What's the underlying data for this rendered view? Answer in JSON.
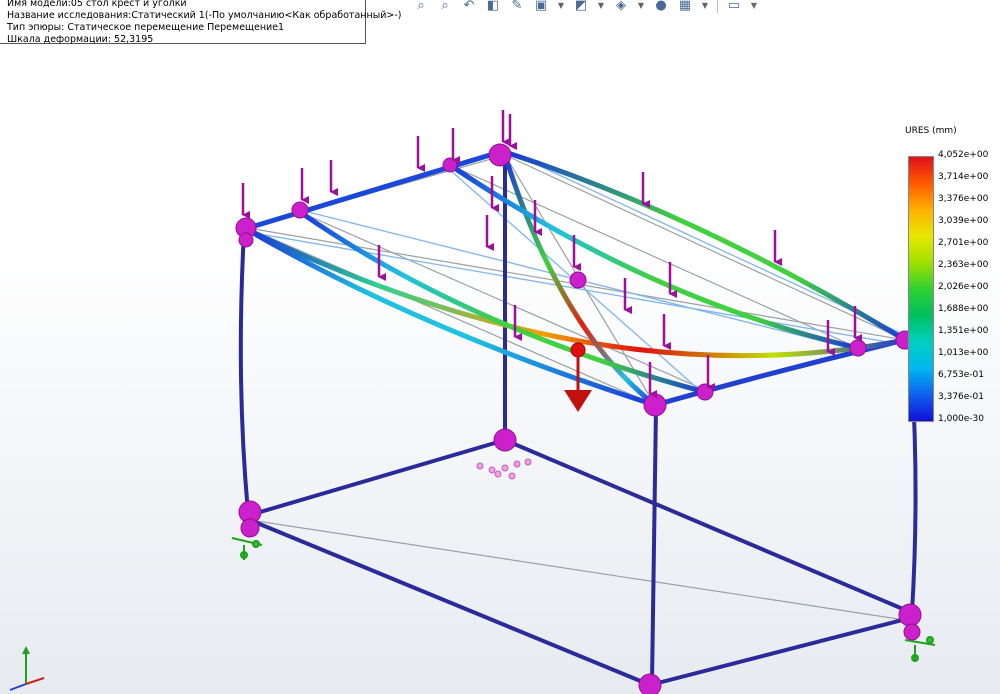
{
  "info": {
    "model_line": "Имя модели:05 стол крест и уголки",
    "study_line": "Название исследования:Статический 1(-По умолчанию<Как обработанный>-)",
    "plot_line": "Тип эпюры: Статическое перемещение Перемещение1",
    "scale_line": "Шкала деформации: 52,3195"
  },
  "toolbar": {
    "icons": [
      "zoom-to-fit-icon",
      "zoom-area-icon",
      "previous-view-icon",
      "section-view-icon",
      "dynamic-annotation-icon",
      "view-orientation-icon",
      "display-style-icon",
      "hide-show-items-icon",
      "edit-appearance-icon",
      "apply-scene-icon",
      "view-settings-icon"
    ]
  },
  "legend": {
    "title": "URES (mm)",
    "labels": [
      "4,052e+00",
      "3,714e+00",
      "3,376e+00",
      "3,039e+00",
      "2,701e+00",
      "2,363e+00",
      "2,026e+00",
      "1,688e+00",
      "1,351e+00",
      "1,013e+00",
      "6,753e-01",
      "3,376e-01",
      "1,000e-30"
    ],
    "colors": {
      "max": "#e0101a",
      "mid": "#30d030",
      "min": "#1010d8"
    }
  },
  "model": {
    "frame_color": "#2a2a9a",
    "load_arrow_color": "#9c109c",
    "fixture_color": "#20a020",
    "undeformed_color": "#9aa0a6",
    "highlight_color": "#7fb6ec"
  }
}
